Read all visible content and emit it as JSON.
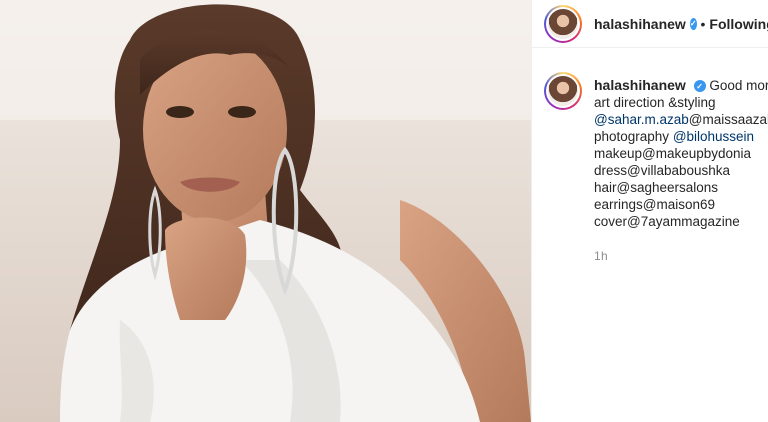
{
  "post": {
    "image_alt": "photo",
    "author": "halashihanew",
    "verified_icon": "verified-badge-icon",
    "separator": "•",
    "follow_status": "Following"
  },
  "caption": {
    "author": "halashihanew",
    "intro": "Good mornin",
    "lines": [
      {
        "prefix": "art direction &styling",
        "mention": "",
        "suffix": ""
      },
      {
        "prefix": "",
        "mention": "@sahar.m.azab",
        "suffix": "@maissaazab"
      },
      {
        "prefix": "photography ",
        "mention": "@bilohussein",
        "suffix": ""
      },
      {
        "prefix": "makeup@makeupbydonia",
        "mention": "",
        "suffix": ""
      },
      {
        "prefix": "dress@villababoushka",
        "mention": "",
        "suffix": ""
      },
      {
        "prefix": "hair@sagheersalons",
        "mention": "",
        "suffix": ""
      },
      {
        "prefix": "earrings@maison69",
        "mention": "",
        "suffix": ""
      },
      {
        "prefix": "cover@7ayammagazine",
        "mention": "",
        "suffix": ""
      }
    ],
    "time_ago": "1h"
  },
  "colors": {
    "verified": "#3897f0",
    "mention": "#003569",
    "muted": "#8e8e8e"
  }
}
